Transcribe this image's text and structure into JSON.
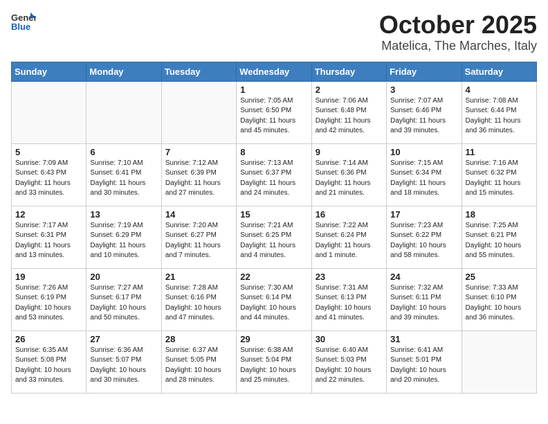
{
  "header": {
    "logo_general": "General",
    "logo_blue": "Blue",
    "month": "October 2025",
    "location": "Matelica, The Marches, Italy"
  },
  "days_of_week": [
    "Sunday",
    "Monday",
    "Tuesday",
    "Wednesday",
    "Thursday",
    "Friday",
    "Saturday"
  ],
  "weeks": [
    [
      {
        "day": "",
        "info": ""
      },
      {
        "day": "",
        "info": ""
      },
      {
        "day": "",
        "info": ""
      },
      {
        "day": "1",
        "info": "Sunrise: 7:05 AM\nSunset: 6:50 PM\nDaylight: 11 hours\nand 45 minutes."
      },
      {
        "day": "2",
        "info": "Sunrise: 7:06 AM\nSunset: 6:48 PM\nDaylight: 11 hours\nand 42 minutes."
      },
      {
        "day": "3",
        "info": "Sunrise: 7:07 AM\nSunset: 6:46 PM\nDaylight: 11 hours\nand 39 minutes."
      },
      {
        "day": "4",
        "info": "Sunrise: 7:08 AM\nSunset: 6:44 PM\nDaylight: 11 hours\nand 36 minutes."
      }
    ],
    [
      {
        "day": "5",
        "info": "Sunrise: 7:09 AM\nSunset: 6:43 PM\nDaylight: 11 hours\nand 33 minutes."
      },
      {
        "day": "6",
        "info": "Sunrise: 7:10 AM\nSunset: 6:41 PM\nDaylight: 11 hours\nand 30 minutes."
      },
      {
        "day": "7",
        "info": "Sunrise: 7:12 AM\nSunset: 6:39 PM\nDaylight: 11 hours\nand 27 minutes."
      },
      {
        "day": "8",
        "info": "Sunrise: 7:13 AM\nSunset: 6:37 PM\nDaylight: 11 hours\nand 24 minutes."
      },
      {
        "day": "9",
        "info": "Sunrise: 7:14 AM\nSunset: 6:36 PM\nDaylight: 11 hours\nand 21 minutes."
      },
      {
        "day": "10",
        "info": "Sunrise: 7:15 AM\nSunset: 6:34 PM\nDaylight: 11 hours\nand 18 minutes."
      },
      {
        "day": "11",
        "info": "Sunrise: 7:16 AM\nSunset: 6:32 PM\nDaylight: 11 hours\nand 15 minutes."
      }
    ],
    [
      {
        "day": "12",
        "info": "Sunrise: 7:17 AM\nSunset: 6:31 PM\nDaylight: 11 hours\nand 13 minutes."
      },
      {
        "day": "13",
        "info": "Sunrise: 7:19 AM\nSunset: 6:29 PM\nDaylight: 11 hours\nand 10 minutes."
      },
      {
        "day": "14",
        "info": "Sunrise: 7:20 AM\nSunset: 6:27 PM\nDaylight: 11 hours\nand 7 minutes."
      },
      {
        "day": "15",
        "info": "Sunrise: 7:21 AM\nSunset: 6:25 PM\nDaylight: 11 hours\nand 4 minutes."
      },
      {
        "day": "16",
        "info": "Sunrise: 7:22 AM\nSunset: 6:24 PM\nDaylight: 11 hours\nand 1 minute."
      },
      {
        "day": "17",
        "info": "Sunrise: 7:23 AM\nSunset: 6:22 PM\nDaylight: 10 hours\nand 58 minutes."
      },
      {
        "day": "18",
        "info": "Sunrise: 7:25 AM\nSunset: 6:21 PM\nDaylight: 10 hours\nand 55 minutes."
      }
    ],
    [
      {
        "day": "19",
        "info": "Sunrise: 7:26 AM\nSunset: 6:19 PM\nDaylight: 10 hours\nand 53 minutes."
      },
      {
        "day": "20",
        "info": "Sunrise: 7:27 AM\nSunset: 6:17 PM\nDaylight: 10 hours\nand 50 minutes."
      },
      {
        "day": "21",
        "info": "Sunrise: 7:28 AM\nSunset: 6:16 PM\nDaylight: 10 hours\nand 47 minutes."
      },
      {
        "day": "22",
        "info": "Sunrise: 7:30 AM\nSunset: 6:14 PM\nDaylight: 10 hours\nand 44 minutes."
      },
      {
        "day": "23",
        "info": "Sunrise: 7:31 AM\nSunset: 6:13 PM\nDaylight: 10 hours\nand 41 minutes."
      },
      {
        "day": "24",
        "info": "Sunrise: 7:32 AM\nSunset: 6:11 PM\nDaylight: 10 hours\nand 39 minutes."
      },
      {
        "day": "25",
        "info": "Sunrise: 7:33 AM\nSunset: 6:10 PM\nDaylight: 10 hours\nand 36 minutes."
      }
    ],
    [
      {
        "day": "26",
        "info": "Sunrise: 6:35 AM\nSunset: 5:08 PM\nDaylight: 10 hours\nand 33 minutes."
      },
      {
        "day": "27",
        "info": "Sunrise: 6:36 AM\nSunset: 5:07 PM\nDaylight: 10 hours\nand 30 minutes."
      },
      {
        "day": "28",
        "info": "Sunrise: 6:37 AM\nSunset: 5:05 PM\nDaylight: 10 hours\nand 28 minutes."
      },
      {
        "day": "29",
        "info": "Sunrise: 6:38 AM\nSunset: 5:04 PM\nDaylight: 10 hours\nand 25 minutes."
      },
      {
        "day": "30",
        "info": "Sunrise: 6:40 AM\nSunset: 5:03 PM\nDaylight: 10 hours\nand 22 minutes."
      },
      {
        "day": "31",
        "info": "Sunrise: 6:41 AM\nSunset: 5:01 PM\nDaylight: 10 hours\nand 20 minutes."
      },
      {
        "day": "",
        "info": ""
      }
    ]
  ]
}
